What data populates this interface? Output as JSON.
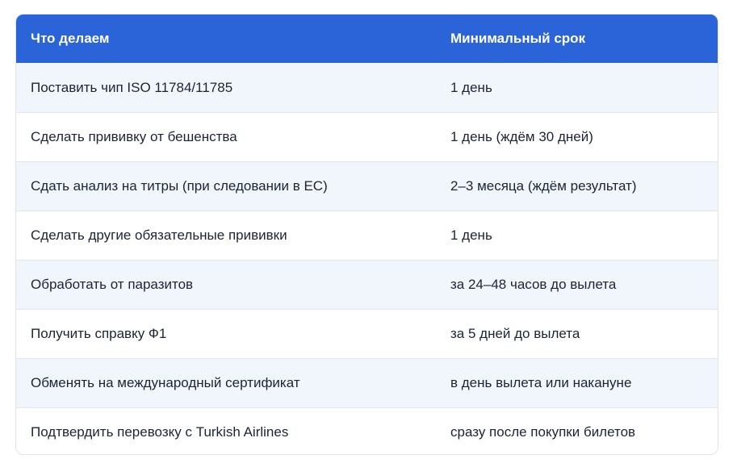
{
  "header": {
    "col1": "Что делаем",
    "col2": "Минимальный срок"
  },
  "rows": [
    {
      "task": "Поставить чип ISO 11784/11785",
      "term": "1 день"
    },
    {
      "task": "Сделать прививку от бешенства",
      "term": "1 день (ждём 30 дней)"
    },
    {
      "task": "Сдать анализ на титры (при следовании в ЕС)",
      "term": "2–3 месяца (ждём результат)"
    },
    {
      "task": "Сделать другие обязательные прививки",
      "term": "1 день"
    },
    {
      "task": "Обработать от паразитов",
      "term": "за 24–48 часов до вылета"
    },
    {
      "task": "Получить справку Ф1",
      "term": "за 5 дней до вылета"
    },
    {
      "task": "Обменять на международный сертификат",
      "term": "в день вылета или накануне"
    },
    {
      "task": "Подтвердить перевозку с Turkish Airlines",
      "term": "сразу после покупки билетов"
    }
  ],
  "colors": {
    "header_bg": "#2b63d9",
    "row_alt_bg": "#f1f6fd",
    "text": "#1c2433"
  }
}
